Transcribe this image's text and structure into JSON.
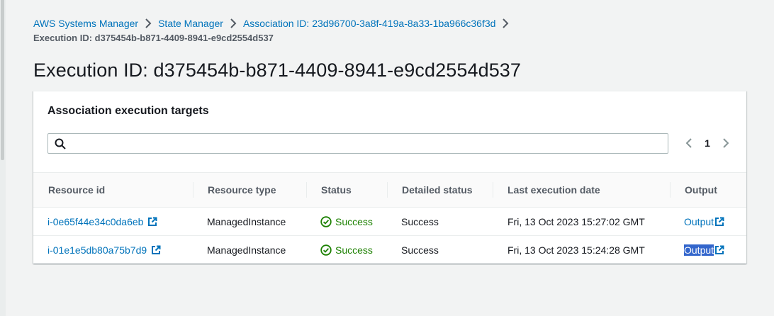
{
  "breadcrumb": {
    "items": [
      "AWS Systems Manager",
      "State Manager",
      "Association ID: 23d96700-3a8f-419a-8a33-1ba966c36f3d"
    ],
    "current": "Execution ID: d375454b-b871-4409-8941-e9cd2554d537"
  },
  "page_title": "Execution ID: d375454b-b871-4409-8941-e9cd2554d537",
  "panel": {
    "header": "Association execution targets",
    "search": {
      "value": "",
      "placeholder": ""
    },
    "pagination": {
      "current_page": "1"
    }
  },
  "table": {
    "columns": [
      "Resource id",
      "Resource type",
      "Status",
      "Detailed status",
      "Last execution date",
      "Output"
    ],
    "rows": [
      {
        "resource_id": "i-0e65f44e34c0da6eb",
        "resource_type": "ManagedInstance",
        "status": "Success",
        "detailed_status": "Success",
        "last_execution_date": "Fri, 13 Oct 2023 15:27:02 GMT",
        "output": "Output"
      },
      {
        "resource_id": "i-01e1e5db80a75b7d9",
        "resource_type": "ManagedInstance",
        "status": "Success",
        "detailed_status": "Success",
        "last_execution_date": "Fri, 13 Oct 2023 15:24:28 GMT",
        "output": "Output"
      }
    ]
  },
  "colors": {
    "link": "#0073bb",
    "success": "#1d8102",
    "background": "#f2f3f3",
    "selection": "#3366cc"
  },
  "icons": [
    "search-icon",
    "chevron-right-icon",
    "chevron-left-icon",
    "external-link-icon",
    "success-check-icon"
  ]
}
